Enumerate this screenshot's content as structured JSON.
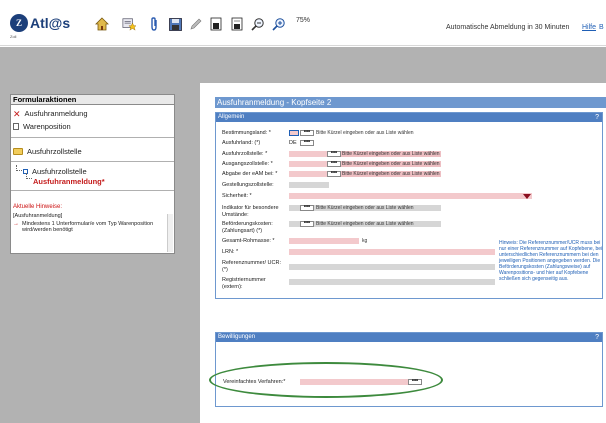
{
  "toolbar": {
    "logo_text": "Atl@s",
    "logo_sub": "Zoll",
    "zoom": "75%",
    "logout_notice": "Automatische Abmeldung in 30 Minuten",
    "help_label": "Hilfe",
    "help_label2": "B"
  },
  "sidebar": {
    "header": "Formularaktionen",
    "actions": [
      {
        "label": "Ausfuhranmeldung",
        "icon": "red-x-icon"
      },
      {
        "label": "Warenposition",
        "icon": "document-icon"
      }
    ],
    "folder": {
      "label": "Ausfuhrzollstelle",
      "icon": "folder-icon"
    },
    "tree": [
      {
        "label": "Ausfuhrzollstelle"
      },
      {
        "label": "Ausfuhranmeldung*"
      }
    ],
    "hints_title": "Aktuelle Hinweise:",
    "hints": [
      "[Ausfuhranmeldung]",
      "Mindestens 1 Unterformular/e vom Typ Warenposition wird/werden benötigt"
    ]
  },
  "form": {
    "title": "Ausfuhranmeldung - Kopfseite 2",
    "section_allgemein": "Allgemein",
    "section_bewilligungen": "Bewilligungen",
    "help_q": "?",
    "ausfuhrland_value": "DE",
    "pick_hint": "Bitte Kürzel eingeben oder aus Liste wählen",
    "unit_kg": "kg",
    "dots": "•••",
    "fields": [
      {
        "label": "Bestimmungsland: *"
      },
      {
        "label": "Ausfuhrland: (*)"
      },
      {
        "label": "Ausfuhrzollstelle: *"
      },
      {
        "label": "Ausgangszollstelle: *"
      },
      {
        "label": "Abgabe der eAM bei: *"
      },
      {
        "label": "Gestellungszollstelle:"
      },
      {
        "label": "Sicherheit: *"
      },
      {
        "label": "Indikator für besondere Umstände:"
      },
      {
        "label": "Beförderungskosten: (Zahlungsart) (*)"
      },
      {
        "label": "Gesamt-Rohmasse: *"
      },
      {
        "label": "LRN: *"
      },
      {
        "label": "Referenznummer/ UCR: (*)"
      },
      {
        "label": "Registriernummer (extern):"
      }
    ],
    "side_hint": "Hinweis: Die Referenznummer/UCR muss bei nur einer Referenznummer auf Kopfebene, bei unterschiedlichen Referenznummern bei den jeweiligen Positionen angegeben werden. Die Beförderungskosten (Zahlungsweise) auf Warenpositions- und hier auf Kopfebene schließen sich gegenseitig aus.",
    "vereinfachtes_label": "Vereinfachtes Verfahren:*"
  }
}
